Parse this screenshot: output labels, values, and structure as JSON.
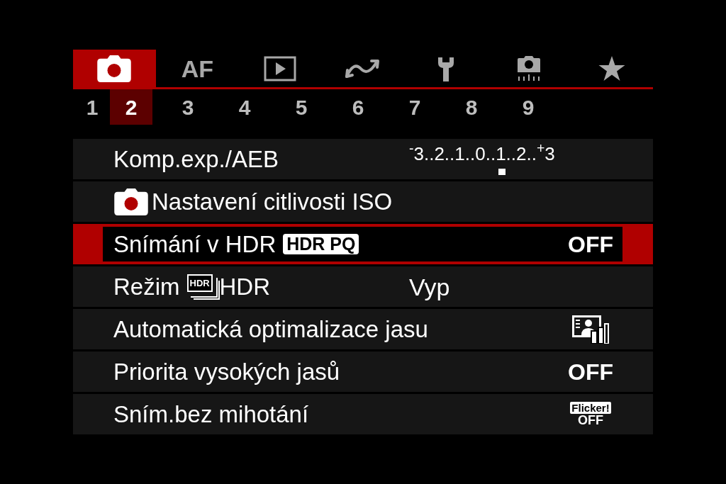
{
  "tabs": [
    {
      "kind": "camera",
      "selected": true
    },
    {
      "kind": "text",
      "label": "AF",
      "selected": false
    },
    {
      "kind": "playback",
      "selected": false
    },
    {
      "kind": "wave",
      "selected": false
    },
    {
      "kind": "wrench",
      "selected": false
    },
    {
      "kind": "custom",
      "selected": false
    },
    {
      "kind": "star",
      "selected": false
    }
  ],
  "pages": [
    {
      "label": "1",
      "selected": false
    },
    {
      "label": "2",
      "selected": true
    },
    {
      "label": "3",
      "selected": false
    },
    {
      "label": "4",
      "selected": false
    },
    {
      "label": "5",
      "selected": false
    },
    {
      "label": "6",
      "selected": false
    },
    {
      "label": "7",
      "selected": false
    },
    {
      "label": "8",
      "selected": false
    },
    {
      "label": "9",
      "selected": false
    }
  ],
  "rows": [
    {
      "kind": "scale",
      "label": "Komp.exp./AEB",
      "scale": "$^{-}$3..2..1..0..1..2..$^{+}$3",
      "selected": false
    },
    {
      "kind": "camera_label",
      "label": "Nastavení citlivosti ISO",
      "selected": false
    },
    {
      "kind": "badge",
      "label": "Snímání v HDR",
      "badge": "HDR PQ",
      "value": "OFF",
      "selected": true
    },
    {
      "kind": "hdr_mode",
      "label": "Režim",
      "icon_text": "HDR",
      "label_end": "HDR",
      "value": "Vyp",
      "selected": false
    },
    {
      "kind": "icon_value",
      "label": "Automatická optimalizace jasu",
      "selected": false
    },
    {
      "kind": "text_value",
      "label": "Priorita vysokých jasů",
      "value": "OFF",
      "selected": false
    },
    {
      "kind": "flicker",
      "label": "Sním.bez mihotání",
      "badge": "Flicker!",
      "value": "OFF",
      "selected": false
    }
  ]
}
